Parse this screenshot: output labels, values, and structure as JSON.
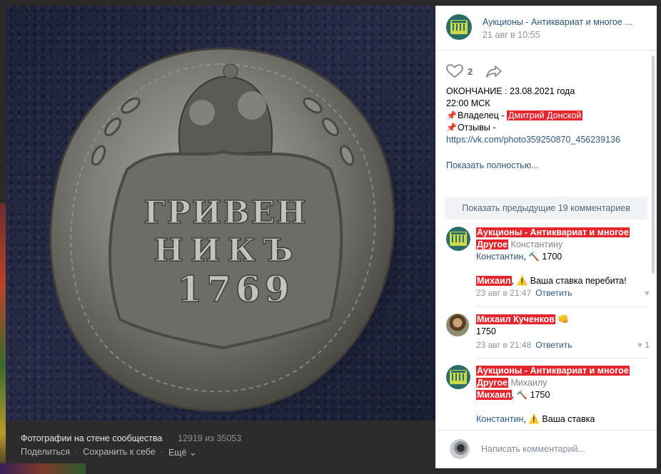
{
  "photo": {
    "coin_text": [
      "ГРИВЕН",
      "НИКЪ",
      "1769"
    ]
  },
  "footer": {
    "title": "Фотографии на стене сообщества",
    "counter": "12919 из 35053",
    "share": "Поделиться",
    "save": "Сохранить к себе",
    "more": "Ещё"
  },
  "header": {
    "group_name": "Аукционы - Антиквариат и многое ...",
    "date": "21 авг в 10:55"
  },
  "likes": {
    "count": "2"
  },
  "post": {
    "line1": "ОКОНЧАНИЕ : 23.08.2021 года",
    "line2": "22:00 МСК",
    "owner_label": "Владелец - ",
    "owner_name": "Дмитрий Донской",
    "reviews_label": "Отзывы -",
    "reviews_link": "https://vk.com/photo359250870_456239136",
    "show_full": "Показать полностью..."
  },
  "show_prev": "Показать предыдущие 19 комментариев",
  "comments": [
    {
      "author_line1": "Аукционы - Антиквариат и многое",
      "author_line2": "Другое",
      "reply_to": " Константину",
      "mention": "Константин",
      "text": ", 🔨 1700"
    },
    {
      "author": "Михаил",
      "text": ", ⚠️ Ваша ставка перебита!",
      "date": "23 авг в 21:47",
      "reply": "Ответить"
    },
    {
      "author": "Михаил Кученков",
      "emoji": " 👊",
      "text": "1750",
      "date": "23 авг в 21:48",
      "reply": "Ответить",
      "likes": "1"
    },
    {
      "author_line1": "Аукционы - Антиквариат и многое",
      "author_line2": "Другое",
      "reply_to": " Михаилу",
      "mention": "Михаил",
      "text": ", 🔨 1750"
    },
    {
      "mention": "Константин",
      "text": ", ⚠️ Ваша ставка"
    }
  ],
  "comment_input": {
    "placeholder": "Написать комментарий..."
  }
}
